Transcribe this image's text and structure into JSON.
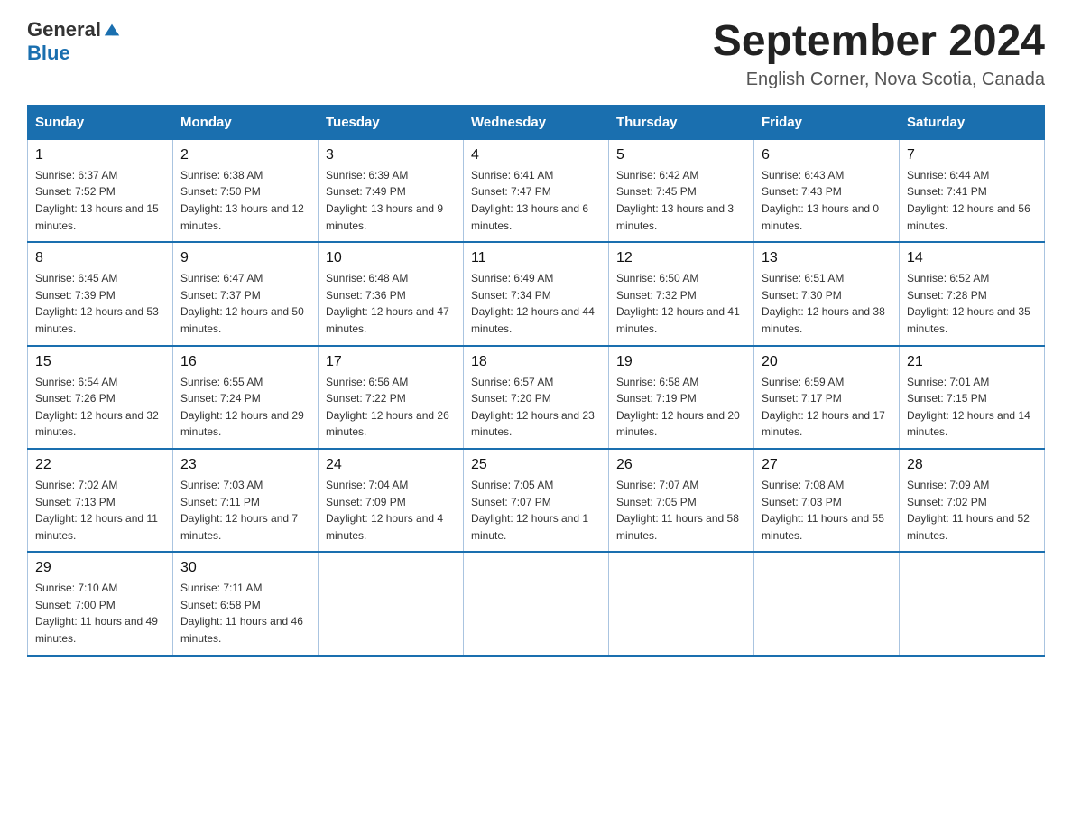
{
  "header": {
    "logo_general": "General",
    "logo_blue": "Blue",
    "month_title": "September 2024",
    "location": "English Corner, Nova Scotia, Canada"
  },
  "weekdays": [
    "Sunday",
    "Monday",
    "Tuesday",
    "Wednesday",
    "Thursday",
    "Friday",
    "Saturday"
  ],
  "weeks": [
    [
      {
        "day": "1",
        "sunrise": "6:37 AM",
        "sunset": "7:52 PM",
        "daylight": "13 hours and 15 minutes."
      },
      {
        "day": "2",
        "sunrise": "6:38 AM",
        "sunset": "7:50 PM",
        "daylight": "13 hours and 12 minutes."
      },
      {
        "day": "3",
        "sunrise": "6:39 AM",
        "sunset": "7:49 PM",
        "daylight": "13 hours and 9 minutes."
      },
      {
        "day": "4",
        "sunrise": "6:41 AM",
        "sunset": "7:47 PM",
        "daylight": "13 hours and 6 minutes."
      },
      {
        "day": "5",
        "sunrise": "6:42 AM",
        "sunset": "7:45 PM",
        "daylight": "13 hours and 3 minutes."
      },
      {
        "day": "6",
        "sunrise": "6:43 AM",
        "sunset": "7:43 PM",
        "daylight": "13 hours and 0 minutes."
      },
      {
        "day": "7",
        "sunrise": "6:44 AM",
        "sunset": "7:41 PM",
        "daylight": "12 hours and 56 minutes."
      }
    ],
    [
      {
        "day": "8",
        "sunrise": "6:45 AM",
        "sunset": "7:39 PM",
        "daylight": "12 hours and 53 minutes."
      },
      {
        "day": "9",
        "sunrise": "6:47 AM",
        "sunset": "7:37 PM",
        "daylight": "12 hours and 50 minutes."
      },
      {
        "day": "10",
        "sunrise": "6:48 AM",
        "sunset": "7:36 PM",
        "daylight": "12 hours and 47 minutes."
      },
      {
        "day": "11",
        "sunrise": "6:49 AM",
        "sunset": "7:34 PM",
        "daylight": "12 hours and 44 minutes."
      },
      {
        "day": "12",
        "sunrise": "6:50 AM",
        "sunset": "7:32 PM",
        "daylight": "12 hours and 41 minutes."
      },
      {
        "day": "13",
        "sunrise": "6:51 AM",
        "sunset": "7:30 PM",
        "daylight": "12 hours and 38 minutes."
      },
      {
        "day": "14",
        "sunrise": "6:52 AM",
        "sunset": "7:28 PM",
        "daylight": "12 hours and 35 minutes."
      }
    ],
    [
      {
        "day": "15",
        "sunrise": "6:54 AM",
        "sunset": "7:26 PM",
        "daylight": "12 hours and 32 minutes."
      },
      {
        "day": "16",
        "sunrise": "6:55 AM",
        "sunset": "7:24 PM",
        "daylight": "12 hours and 29 minutes."
      },
      {
        "day": "17",
        "sunrise": "6:56 AM",
        "sunset": "7:22 PM",
        "daylight": "12 hours and 26 minutes."
      },
      {
        "day": "18",
        "sunrise": "6:57 AM",
        "sunset": "7:20 PM",
        "daylight": "12 hours and 23 minutes."
      },
      {
        "day": "19",
        "sunrise": "6:58 AM",
        "sunset": "7:19 PM",
        "daylight": "12 hours and 20 minutes."
      },
      {
        "day": "20",
        "sunrise": "6:59 AM",
        "sunset": "7:17 PM",
        "daylight": "12 hours and 17 minutes."
      },
      {
        "day": "21",
        "sunrise": "7:01 AM",
        "sunset": "7:15 PM",
        "daylight": "12 hours and 14 minutes."
      }
    ],
    [
      {
        "day": "22",
        "sunrise": "7:02 AM",
        "sunset": "7:13 PM",
        "daylight": "12 hours and 11 minutes."
      },
      {
        "day": "23",
        "sunrise": "7:03 AM",
        "sunset": "7:11 PM",
        "daylight": "12 hours and 7 minutes."
      },
      {
        "day": "24",
        "sunrise": "7:04 AM",
        "sunset": "7:09 PM",
        "daylight": "12 hours and 4 minutes."
      },
      {
        "day": "25",
        "sunrise": "7:05 AM",
        "sunset": "7:07 PM",
        "daylight": "12 hours and 1 minute."
      },
      {
        "day": "26",
        "sunrise": "7:07 AM",
        "sunset": "7:05 PM",
        "daylight": "11 hours and 58 minutes."
      },
      {
        "day": "27",
        "sunrise": "7:08 AM",
        "sunset": "7:03 PM",
        "daylight": "11 hours and 55 minutes."
      },
      {
        "day": "28",
        "sunrise": "7:09 AM",
        "sunset": "7:02 PM",
        "daylight": "11 hours and 52 minutes."
      }
    ],
    [
      {
        "day": "29",
        "sunrise": "7:10 AM",
        "sunset": "7:00 PM",
        "daylight": "11 hours and 49 minutes."
      },
      {
        "day": "30",
        "sunrise": "7:11 AM",
        "sunset": "6:58 PM",
        "daylight": "11 hours and 46 minutes."
      },
      null,
      null,
      null,
      null,
      null
    ]
  ]
}
